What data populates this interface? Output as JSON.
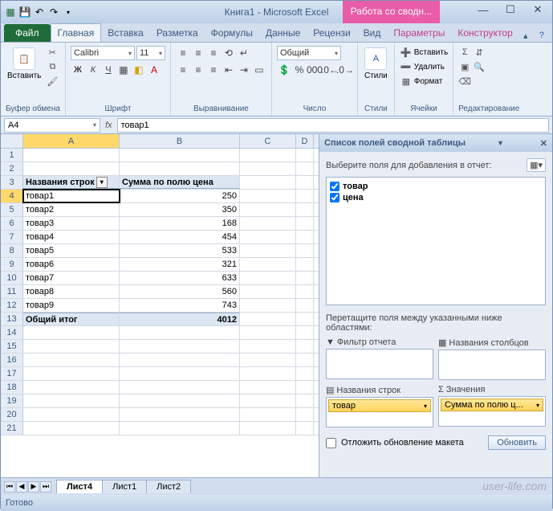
{
  "title": "Книга1 - Microsoft Excel",
  "context_tab": "Работа со сводн...",
  "tabs": {
    "file": "Файл",
    "home": "Главная",
    "insert": "Вставка",
    "layout": "Разметка",
    "formulas": "Формулы",
    "data": "Данные",
    "review": "Рецензи",
    "view": "Вид",
    "params": "Параметры",
    "design": "Конструктор"
  },
  "ribbon_groups": {
    "clipboard": "Буфер обмена",
    "font": "Шрифт",
    "align": "Выравнивание",
    "number": "Число",
    "styles": "Стили",
    "cells": "Ячейки",
    "editing": "Редактирование"
  },
  "ribbon": {
    "paste": "Вставить",
    "font_name": "Calibri",
    "font_size": "11",
    "number_format": "Общий",
    "styles_btn": "Стили",
    "insert": "Вставить",
    "delete": "Удалить",
    "format": "Формат"
  },
  "namebox": "A4",
  "formula": "товар1",
  "columns": [
    "A",
    "B",
    "C",
    "D"
  ],
  "headers": {
    "rows": "Названия строк",
    "sum": "Сумма по полю цена"
  },
  "data_rows": [
    {
      "n": "4",
      "a": "товар1",
      "b": "250"
    },
    {
      "n": "5",
      "a": "товар2",
      "b": "350"
    },
    {
      "n": "6",
      "a": "товар3",
      "b": "168"
    },
    {
      "n": "7",
      "a": "товар4",
      "b": "454"
    },
    {
      "n": "8",
      "a": "товар5",
      "b": "533"
    },
    {
      "n": "9",
      "a": "товар6",
      "b": "321"
    },
    {
      "n": "10",
      "a": "товар7",
      "b": "633"
    },
    {
      "n": "11",
      "a": "товар8",
      "b": "560"
    },
    {
      "n": "12",
      "a": "товар9",
      "b": "743"
    }
  ],
  "total": {
    "n": "13",
    "label": "Общий итог",
    "value": "4012"
  },
  "empty_rows": [
    "14",
    "15",
    "16",
    "17",
    "18",
    "19",
    "20",
    "21"
  ],
  "pane": {
    "title": "Список полей сводной таблицы",
    "prompt": "Выберите поля для добавления в отчет:",
    "fields": [
      "товар",
      "цена"
    ],
    "drag": "Перетащите поля между указанными ниже областями:",
    "filter": "Фильтр отчета",
    "cols": "Названия столбцов",
    "rows": "Названия строк",
    "vals": "Значения",
    "row_chip": "товар",
    "val_chip": "Сумма по полю ц...",
    "defer": "Отложить обновление макета",
    "update": "Обновить"
  },
  "sheet_tabs": [
    "Лист4",
    "Лист1",
    "Лист2"
  ],
  "status": "Готово",
  "watermark": "user-life.com"
}
